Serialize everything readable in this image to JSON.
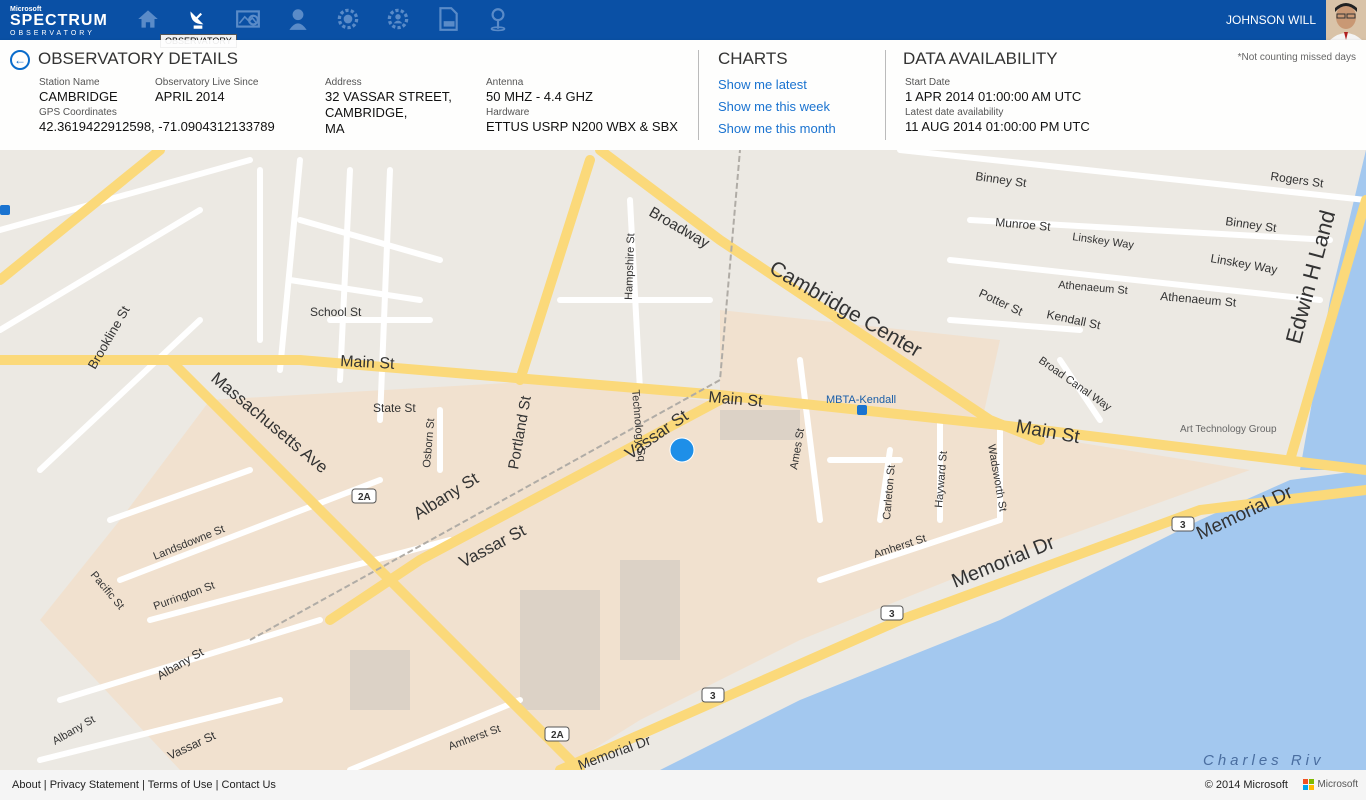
{
  "brand": {
    "ms": "Microsoft",
    "name": "SPECTRUM",
    "sub": "OBSERVATORY"
  },
  "nav": {
    "items": [
      "home-icon",
      "satellite-dish-icon",
      "map-search-icon",
      "person-icon",
      "gear-icon",
      "settings-users-icon",
      "raw-file-icon",
      "location-pin-icon"
    ],
    "tooltip": "OBSERVATORY"
  },
  "user": {
    "name": "JOHNSON WILL"
  },
  "observatory": {
    "title": "OBSERVATORY DETAILS",
    "station_name_label": "Station Name",
    "station_name": "CAMBRIDGE",
    "live_since_label": "Observatory Live Since",
    "live_since": "APRIL 2014",
    "gps_label": "GPS Coordinates",
    "gps": "42.3619422912598, -71.0904312133789",
    "address_label": "Address",
    "address_1": "32 VASSAR STREET,",
    "address_2": "CAMBRIDGE,",
    "address_3": "MA",
    "antenna_label": "Antenna",
    "antenna": "50 MHZ - 4.4 GHZ",
    "hardware_label": "Hardware",
    "hardware": "ETTUS USRP N200 WBX & SBX"
  },
  "charts": {
    "title": "CHARTS",
    "latest": "Show me latest",
    "week": "Show me this week",
    "month": "Show me this month"
  },
  "availability": {
    "title": "DATA AVAILABILITY",
    "note": "*Not counting missed days",
    "start_label": "Start Date",
    "start": "1 APR 2014 01:00:00 AM UTC",
    "latest_label": "Latest date availability",
    "latest": "11 AUG 2014 01:00:00 PM UTC"
  },
  "map": {
    "labels": {
      "main_st": "Main St",
      "main_st_2": "Main St",
      "main_st_3": "Main St",
      "cambridge_center": "Cambridge Center",
      "broadway": "Broadway",
      "vassar_st": "Vassar St",
      "vassar_st_2": "Vassar St",
      "vassar_st_3": "Vassar St",
      "mass_ave": "Massachusetts Ave",
      "memorial_dr": "Memorial Dr",
      "memorial_dr_2": "Memorial Dr",
      "memorial_dr_3": "Memorial Dr",
      "albany_st": "Albany St",
      "albany_st_2": "Albany St",
      "albany_st_3": "Albany St",
      "portland_st": "Portland St",
      "mbta": "MBTA-Kendall",
      "edwin_land": "Edwin H Land",
      "binney_st": "Binney St",
      "binney_st_2": "Binney St",
      "munroe_st": "Munroe St",
      "linskey_way": "Linskey Way",
      "athenaeum_st": "Athenaeum St",
      "potter_st": "Potter St",
      "kendall_st": "Kendall St",
      "broad_canal": "Broad Canal Way",
      "art_tech": "Art Technology Group",
      "ames_st": "Ames St",
      "carleton_st": "Carleton St",
      "hayward_st": "Hayward St",
      "wadsworth_st": "Wadsworth St",
      "amherst_st": "Amherst St",
      "amherst_st_2": "Amherst St",
      "state_st": "State St",
      "osborn_st": "Osborn St",
      "school_st": "School St",
      "charles_river": "Charles Riv",
      "route_2a": "2A",
      "route_3": "3",
      "rogers_st": "Rogers St",
      "hampshire_st": "Hampshire St",
      "technology_sq": "Technology Sq",
      "brookline_st": "Brookline St",
      "landsdowne_st": "Landsdowne St",
      "purrington_st": "Purrington St",
      "pacific_st": "Pacific St"
    }
  },
  "footer": {
    "links": "About | Privacy Statement | Terms of Use | Contact Us",
    "copyright": "© 2014 Microsoft",
    "ms": "Microsoft"
  },
  "colors": {
    "brand": "#0a50a5",
    "link": "#1a73d0",
    "water": "#a3c8ef",
    "campus": "#f1e1cf",
    "road": "#fbd97a"
  }
}
